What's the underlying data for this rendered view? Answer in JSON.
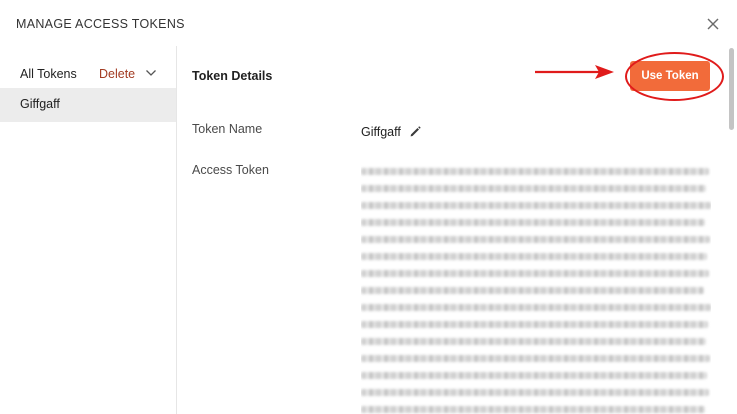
{
  "dialog": {
    "title": "MANAGE ACCESS TOKENS"
  },
  "sidebar": {
    "all_tokens_label": "All Tokens",
    "delete_label": "Delete",
    "items": [
      {
        "label": "Giffgaff",
        "selected": true
      }
    ]
  },
  "details": {
    "heading": "Token Details",
    "use_token_label": "Use Token",
    "token_name_label": "Token Name",
    "token_name_value": "Giffgaff",
    "access_token_label": "Access Token",
    "access_token_state": "blurred"
  },
  "colors": {
    "use_token_button": "#f26b3a",
    "delete_link": "#a23b22",
    "annotation_red": "#e01b1b",
    "selected_item_bg": "#ececec"
  },
  "icons": {
    "close": "close-icon",
    "chevron": "chevron-down-icon",
    "edit": "pencil-icon"
  }
}
